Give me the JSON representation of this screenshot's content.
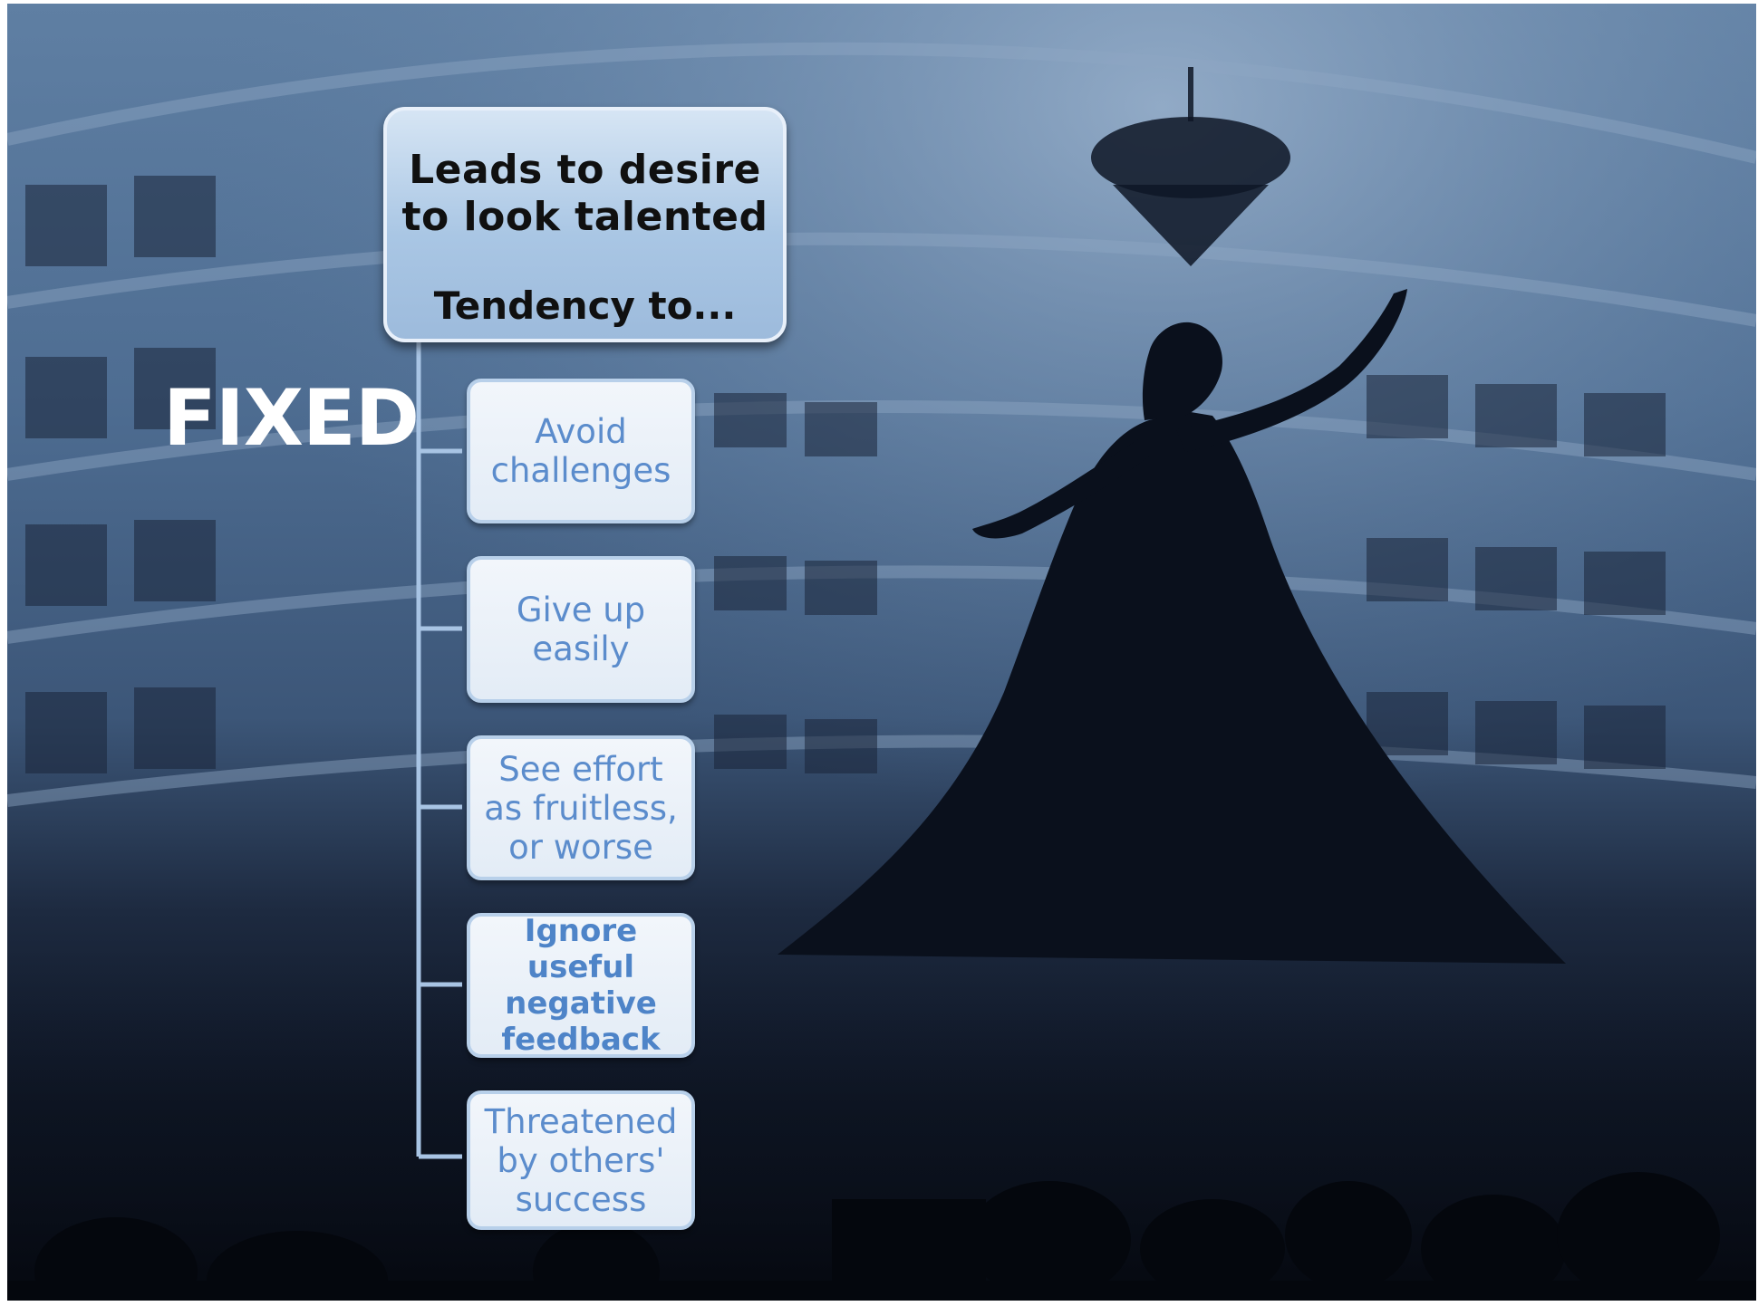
{
  "root": {
    "line1": "Leads to desire\nto look talented",
    "line2": "Tendency to..."
  },
  "title": "FIXED",
  "children": [
    {
      "label": "Avoid\nchallenges",
      "bold": false
    },
    {
      "label": "Give up\neasily",
      "bold": false
    },
    {
      "label": "See effort\nas fruitless,\nor worse",
      "bold": false
    },
    {
      "label": "Ignore useful\nnegative\nfeedback",
      "bold": true
    },
    {
      "label": "Threatened\nby others'\nsuccess",
      "bold": false
    }
  ],
  "colors": {
    "connector": "#a8c4e4",
    "root_fill": "#a9c6e4",
    "child_text": "#5b8ccc"
  }
}
